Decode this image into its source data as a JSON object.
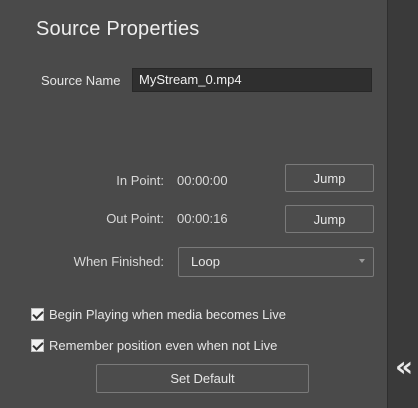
{
  "panel": {
    "title": "Source Properties",
    "source_name_label": "Source Name",
    "source_name_value": "MyStream_0.mp4",
    "in_point_label": "In Point:",
    "in_point_value": "00:00:00",
    "out_point_label": "Out Point:",
    "out_point_value": "00:00:16",
    "jump_label": "Jump",
    "when_finished_label": "When Finished:",
    "when_finished_value": "Loop",
    "checkbox_begin_playing": "Begin Playing when media becomes Live",
    "checkbox_begin_playing_checked": true,
    "checkbox_remember_position": "Remember position even when not Live",
    "checkbox_remember_position_checked": true,
    "set_default_label": "Set Default"
  },
  "sidebar": {
    "collapse_glyph": "«",
    "collapse_icon": "double-chevron-left-icon"
  }
}
